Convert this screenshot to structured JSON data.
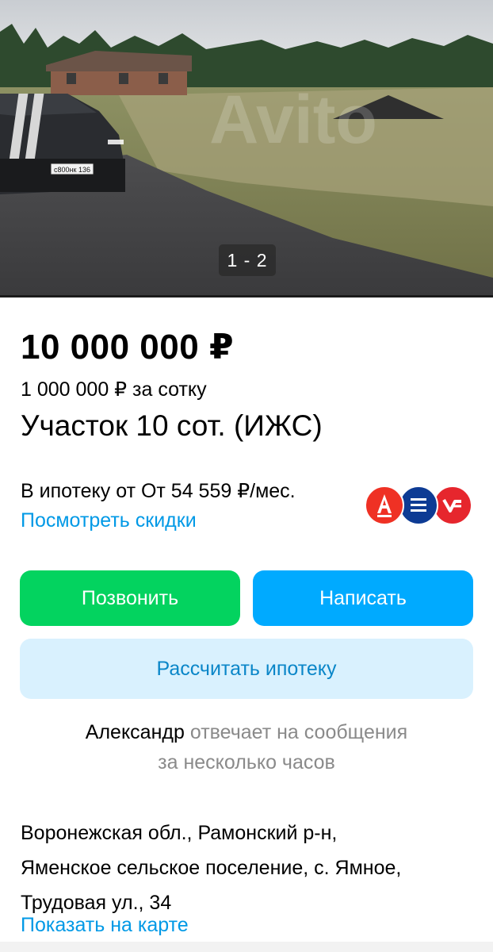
{
  "gallery": {
    "counter": "1 - 2",
    "plate_text": "с800нк 136",
    "watermark": "Avito"
  },
  "listing": {
    "price": "10 000 000 ₽",
    "price_per_unit": "1 000 000 ₽ за сотку",
    "title": "Участок 10 сот. (ИЖС)"
  },
  "mortgage": {
    "text": "В ипотеку от От 54 559 ₽/мес.",
    "discount_link": "Посмотреть скидки",
    "banks": [
      "alfa-bank-icon",
      "gazprombank-icon",
      "vtb-icon"
    ]
  },
  "actions": {
    "call_label": "Позвонить",
    "write_label": "Написать",
    "calc_label": "Рассчитать ипотеку"
  },
  "seller": {
    "name": "Александр",
    "response_line1": "отвечает на сообщения",
    "response_line2": "за несколько часов"
  },
  "location": {
    "line1": "Воронежская обл., Рамонский р-н,",
    "line2": "Яменское сельское поселение, с. Ямное,",
    "line3": "Трудовая ул., 34",
    "map_link": "Показать на карте"
  },
  "colors": {
    "call_button": "#03d35f",
    "write_button": "#00aaff",
    "calc_button_bg": "#d9f1fe",
    "link": "#0099e6"
  }
}
